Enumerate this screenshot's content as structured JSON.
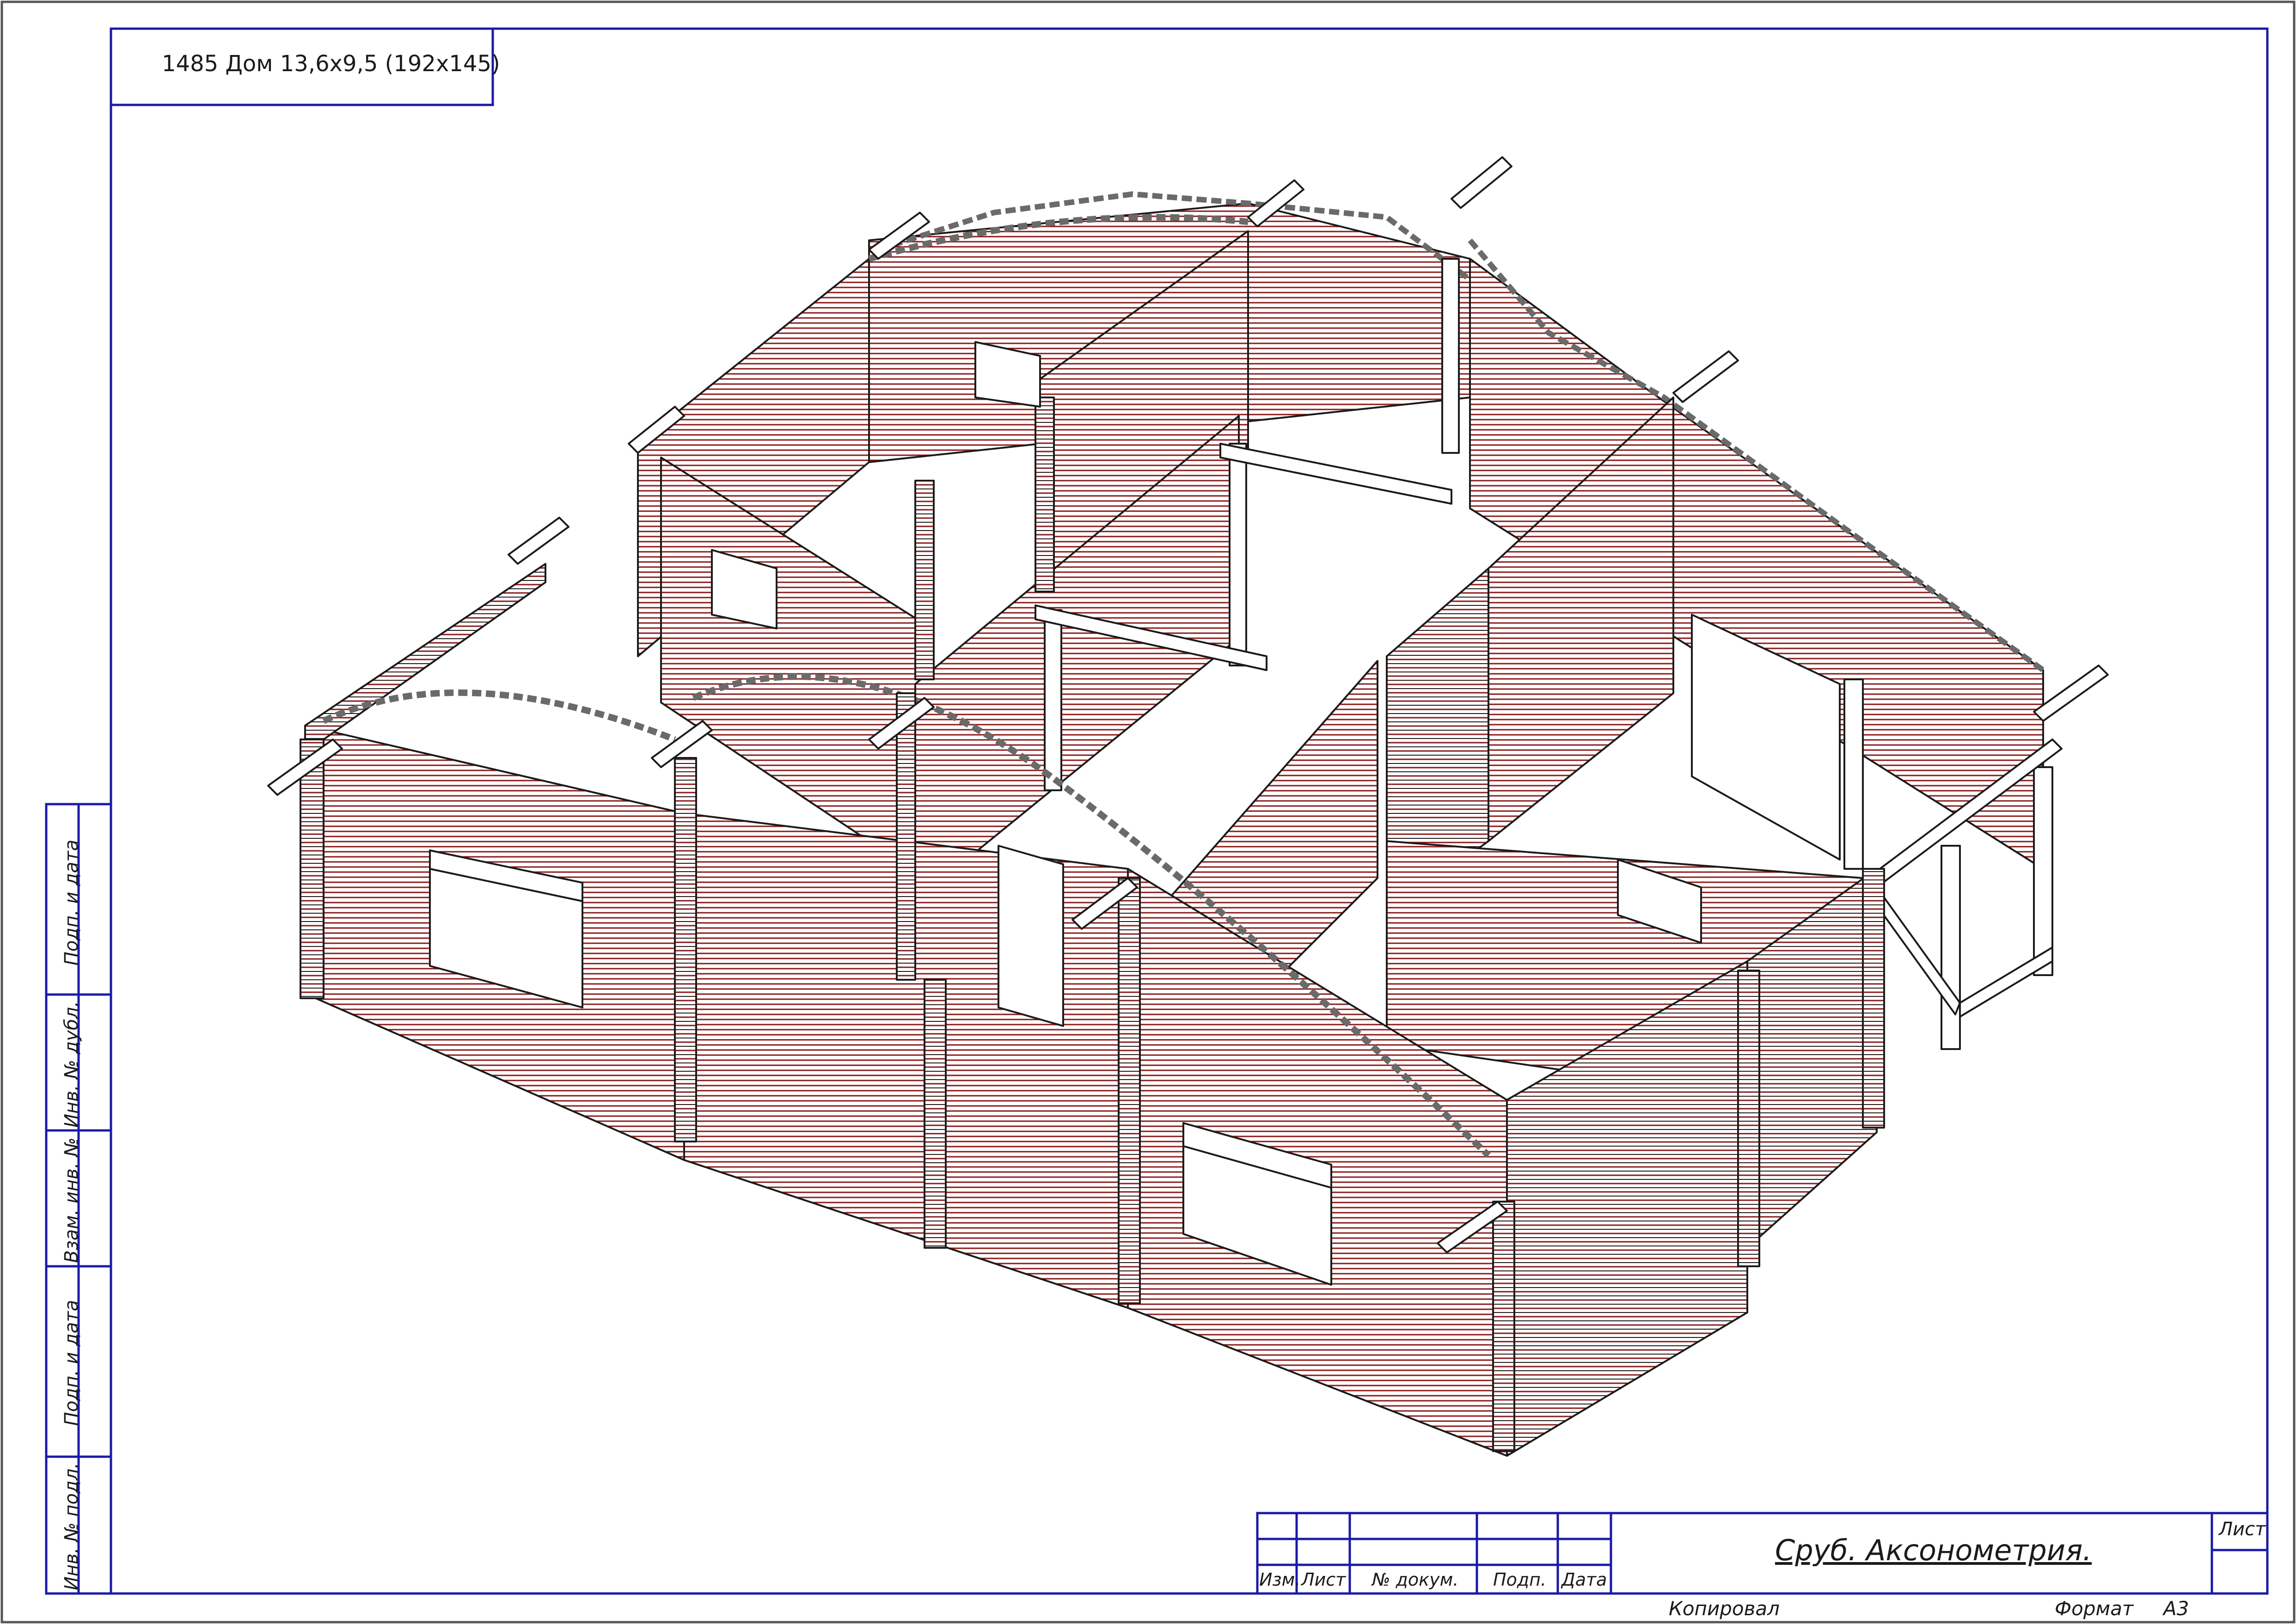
{
  "header": {
    "title_block_text": "1485 Дом 13,6х9,5 (192х145)"
  },
  "side_stamp": {
    "labels": [
      "Подп. и дата",
      "Инв. № дубл.",
      "Взам. инв. №",
      "Подп. и дата",
      "Инв. № подл."
    ]
  },
  "title_block": {
    "columns": [
      "Изм.",
      "Лист",
      "№ докум.",
      "Подп.",
      "Дата"
    ],
    "drawing_title": "Сруб. Аксонометрия.",
    "sheet_label": "Лист",
    "copied_by_label": "Копировал",
    "format_label": "Формат",
    "format_value": "А3"
  },
  "colors": {
    "frame": "#1a1aa8",
    "outer_border": "#555555",
    "outline": "#1b1b1b",
    "log_lines": "#8b1a1a"
  }
}
